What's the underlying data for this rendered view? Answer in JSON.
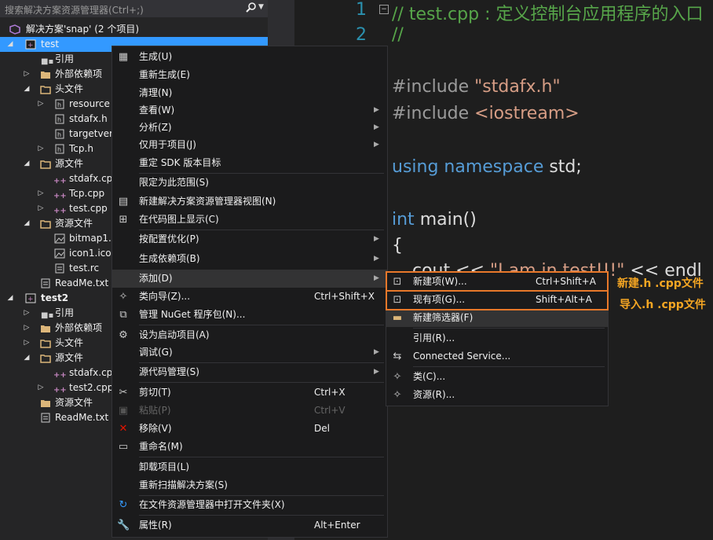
{
  "explorer": {
    "search_placeholder": "搜索解决方案资源管理器(Ctrl+;)",
    "items": [
      {
        "label": "解决方案'snap' (2 个项目)"
      },
      {
        "label": "test"
      },
      {
        "label": "引用"
      },
      {
        "label": "外部依赖项"
      },
      {
        "label": "头文件"
      },
      {
        "label": "resource"
      },
      {
        "label": "stdafx.h"
      },
      {
        "label": "targetver"
      },
      {
        "label": "Tcp.h"
      },
      {
        "label": "源文件"
      },
      {
        "label": "stdafx.cp"
      },
      {
        "label": "Tcp.cpp"
      },
      {
        "label": "test.cpp"
      },
      {
        "label": "资源文件"
      },
      {
        "label": "bitmap1."
      },
      {
        "label": "icon1.ico"
      },
      {
        "label": "test.rc"
      },
      {
        "label": "ReadMe.txt"
      },
      {
        "label": "test2"
      },
      {
        "label": "引用"
      },
      {
        "label": "外部依赖项"
      },
      {
        "label": "头文件"
      },
      {
        "label": "源文件"
      },
      {
        "label": "stdafx.cp"
      },
      {
        "label": "test2.cpp"
      },
      {
        "label": "资源文件"
      },
      {
        "label": "ReadMe.txt"
      }
    ]
  },
  "editor": {
    "line_numbers": [
      "1",
      "2"
    ],
    "lines": {
      "comment1": "// test.cpp : 定义控制台应用程序的入口",
      "comment2": "//",
      "include1_kw": "#include ",
      "include1_file": "\"stdafx.h\"",
      "include2_kw": "#include ",
      "include2_file": "<iostream>",
      "using_kw": "using namespace ",
      "using_ns": "std;",
      "main_kw": "int ",
      "main_rest": "main()",
      "brace": "{",
      "cout_pre": "cout << ",
      "cout_str": "\"I am in test!!!\"",
      "cout_post": " << endl"
    }
  },
  "context_menu": {
    "items": [
      {
        "label": "生成(U)",
        "shortcut": "",
        "icon": "build-icon"
      },
      {
        "label": "重新生成(E)",
        "shortcut": ""
      },
      {
        "label": "清理(N)",
        "shortcut": ""
      },
      {
        "label": "查看(W)",
        "shortcut": "",
        "submenu": true
      },
      {
        "label": "分析(Z)",
        "shortcut": "",
        "submenu": true
      },
      {
        "label": "仅用于项目(J)",
        "shortcut": "",
        "submenu": true
      },
      {
        "label": "重定 SDK 版本目标",
        "shortcut": ""
      },
      {
        "label": "限定为此范围(S)",
        "shortcut": ""
      },
      {
        "label": "新建解决方案资源管理器视图(N)",
        "shortcut": "",
        "icon": "new-view-icon"
      },
      {
        "label": "在代码图上显示(C)",
        "shortcut": "",
        "icon": "code-map-icon"
      },
      {
        "label": "按配置优化(P)",
        "shortcut": "",
        "submenu": true
      },
      {
        "label": "生成依赖项(B)",
        "shortcut": "",
        "submenu": true
      },
      {
        "label": "添加(D)",
        "shortcut": "",
        "submenu": true
      },
      {
        "label": "类向导(Z)...",
        "shortcut": "Ctrl+Shift+X",
        "icon": "class-wizard-icon"
      },
      {
        "label": "管理 NuGet 程序包(N)...",
        "shortcut": "",
        "icon": "nuget-icon"
      },
      {
        "label": "设为启动项目(A)",
        "shortcut": "",
        "icon": "gear-icon"
      },
      {
        "label": "调试(G)",
        "shortcut": "",
        "submenu": true
      },
      {
        "label": "源代码管理(S)",
        "shortcut": "",
        "submenu": true
      },
      {
        "label": "剪切(T)",
        "shortcut": "Ctrl+X",
        "icon": "scissors-icon"
      },
      {
        "label": "粘贴(P)",
        "shortcut": "Ctrl+V",
        "icon": "paste-icon",
        "disabled": true
      },
      {
        "label": "移除(V)",
        "shortcut": "Del",
        "icon": "remove-icon"
      },
      {
        "label": "重命名(M)",
        "shortcut": "",
        "icon": "rename-icon"
      },
      {
        "label": "卸载项目(L)",
        "shortcut": ""
      },
      {
        "label": "重新扫描解决方案(S)",
        "shortcut": ""
      },
      {
        "label": "在文件资源管理器中打开文件夹(X)",
        "shortcut": "",
        "icon": "refresh-icon"
      },
      {
        "label": "属性(R)",
        "shortcut": "Alt+Enter",
        "icon": "wrench-icon"
      }
    ]
  },
  "submenu": {
    "items": [
      {
        "label": "新建项(W)...",
        "shortcut": "Ctrl+Shift+A"
      },
      {
        "label": "现有项(G)...",
        "shortcut": "Shift+Alt+A"
      },
      {
        "label": "新建筛选器(F)",
        "shortcut": ""
      },
      {
        "label": "引用(R)...",
        "shortcut": ""
      },
      {
        "label": "Connected Service...",
        "shortcut": ""
      },
      {
        "label": "类(C)...",
        "shortcut": ""
      },
      {
        "label": "资源(R)...",
        "shortcut": ""
      }
    ]
  },
  "annotations": {
    "new_item": "新建.h .cpp文件",
    "existing_item": "导入.h .cpp文件"
  },
  "colors": {
    "accent": "#3399ff",
    "annotation": "#e8782a"
  }
}
